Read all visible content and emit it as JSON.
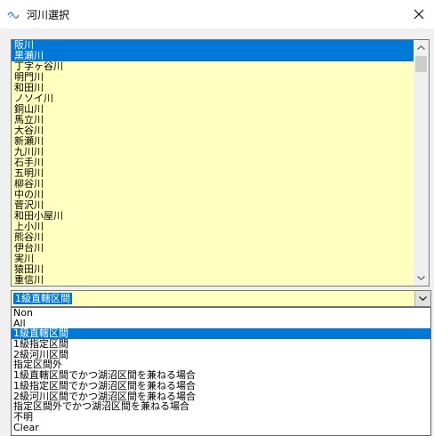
{
  "window": {
    "title": "河川選択"
  },
  "river_list": {
    "items": [
      "阪川",
      "黒瀬川",
      "丁字ヶ谷川",
      "明門川",
      "和田川",
      "ノソイ川",
      "銅山川",
      "馬立川",
      "大谷川",
      "新瀬川",
      "九川川",
      "石手川",
      "五明川",
      "柳谷川",
      "中の川",
      "菅沢川",
      "和田小屋川",
      "上小川",
      "熊谷川",
      "伊台川",
      "実川",
      "猿田川",
      "重信川"
    ],
    "selected_indices": [
      0,
      1
    ]
  },
  "section_combo": {
    "value": "1級直轄区間",
    "options": [
      "Non",
      "All",
      "1級直轄区間",
      "1級指定区間",
      "2級河川区間",
      "指定区間外",
      "1級直轄区間でかつ湖沼区間を兼ねる場合",
      "1級指定区間でかつ湖沼区間を兼ねる場合",
      "2級河川区間でかつ湖沼区間を兼ねる場合",
      "指定区間外でかつ湖沼区間を兼ねる場合",
      "不明",
      "Clear"
    ],
    "selected_index": 2
  },
  "colors": {
    "list_bg": "#ffffc0",
    "selection": "#0078d7"
  }
}
